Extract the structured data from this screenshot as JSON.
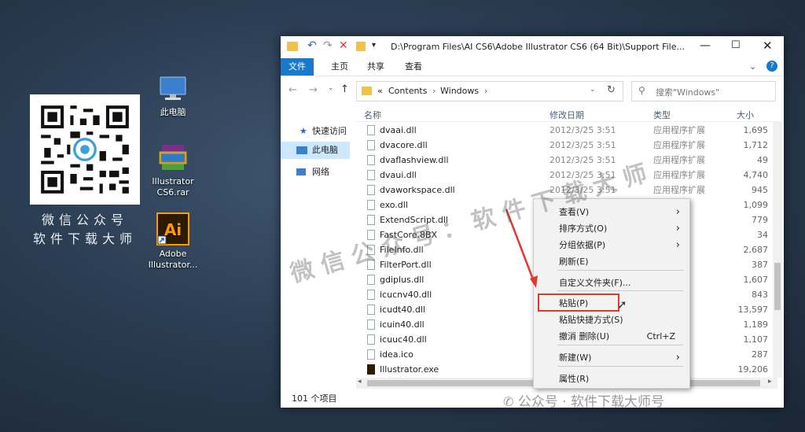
{
  "desktop": {
    "caption_line1": "微信公众号",
    "caption_line2": "软件下载大师",
    "icons": [
      {
        "label": "此电脑"
      },
      {
        "label": "Illustrator\nCS6.rar"
      },
      {
        "label": "Adobe\nIllustrator..."
      }
    ]
  },
  "window": {
    "path": "D:\\Program Files\\AI CS6\\Adobe Illustrator CS6 (64 Bit)\\Support File...",
    "tabs": [
      "文件",
      "主页",
      "共享",
      "查看"
    ],
    "breadcrumb": [
      "«",
      "Contents",
      "Windows"
    ],
    "search_placeholder": "搜索\"Windows\"",
    "nav": [
      "快速访问",
      "此电脑",
      "网络"
    ],
    "columns": {
      "name": "名称",
      "date": "修改日期",
      "type": "类型",
      "size": "大小"
    },
    "rows": [
      {
        "name": "dvaai.dll",
        "date": "2012/3/25 3:51",
        "type": "应用程序扩展",
        "size": "1,695"
      },
      {
        "name": "dvacore.dll",
        "date": "2012/3/25 3:51",
        "type": "应用程序扩展",
        "size": "1,712"
      },
      {
        "name": "dvaflashview.dll",
        "date": "2012/3/25 3:51",
        "type": "应用程序扩展",
        "size": "49"
      },
      {
        "name": "dvaui.dll",
        "date": "2012/3/25 3:51",
        "type": "应用程序扩展",
        "size": "4,740"
      },
      {
        "name": "dvaworkspace.dll",
        "date": "2012/3/25 3:51",
        "type": "应用程序扩展",
        "size": "945"
      },
      {
        "name": "exo.dll",
        "date": "",
        "type": "",
        "size": "1,099"
      },
      {
        "name": "ExtendScript.dll",
        "date": "",
        "type": "",
        "size": "779"
      },
      {
        "name": "FastCore.8BX",
        "date": "",
        "type": "",
        "size": "34"
      },
      {
        "name": "FileInfo.dll",
        "date": "",
        "type": "扩展",
        "size": "2,687"
      },
      {
        "name": "FilterPort.dll",
        "date": "",
        "type": "扩展",
        "size": "387"
      },
      {
        "name": "gdiplus.dll",
        "date": "",
        "type": "扩展",
        "size": "1,607"
      },
      {
        "name": "icucnv40.dll",
        "date": "",
        "type": "扩展",
        "size": "843"
      },
      {
        "name": "icudt40.dll",
        "date": "",
        "type": "扩展",
        "size": "13,597"
      },
      {
        "name": "icuin40.dll",
        "date": "",
        "type": "扩展",
        "size": "1,189"
      },
      {
        "name": "icuuc40.dll",
        "date": "",
        "type": "扩展",
        "size": "1,107"
      },
      {
        "name": "idea.ico",
        "date": "",
        "type": "",
        "size": "287"
      },
      {
        "name": "Illustrator.exe",
        "date": "",
        "type": "",
        "size": "19,206"
      }
    ],
    "status": "101 个项目"
  },
  "context_menu": [
    {
      "label": "查看(V)",
      "arrow": "›"
    },
    {
      "label": "排序方式(O)",
      "arrow": "›"
    },
    {
      "label": "分组依据(P)",
      "arrow": "›"
    },
    {
      "label": "刷新(E)",
      "arrow": ""
    },
    {
      "label": "自定义文件夹(F)...",
      "arrow": ""
    },
    {
      "label": "粘贴(P)",
      "arrow": ""
    },
    {
      "label": "粘贴快捷方式(S)",
      "arrow": ""
    },
    {
      "label": "撤消 删除(U)",
      "shortcut": "Ctrl+Z"
    },
    {
      "label": "新建(W)",
      "arrow": "›"
    },
    {
      "label": "属性(R)",
      "arrow": ""
    }
  ],
  "watermark": {
    "diagonal": "微信公众号：软件下载大师",
    "footer": "公众号 · 软件下载大师号"
  }
}
